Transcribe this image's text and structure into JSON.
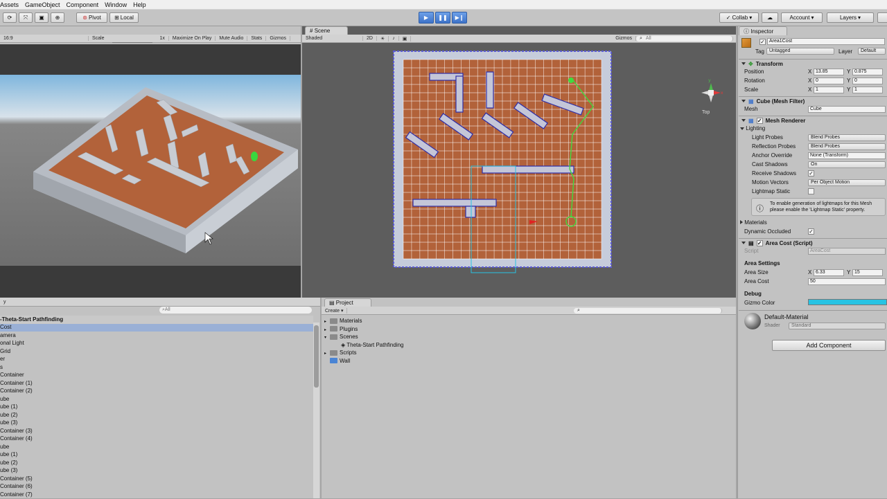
{
  "menu": [
    "Assets",
    "GameObject",
    "Component",
    "Window",
    "Help"
  ],
  "toolbar": {
    "pivot": "Pivot",
    "local": "Local",
    "collab": "Collab",
    "account": "Account",
    "layers": "Layers"
  },
  "game_view": {
    "aspect": "16:9",
    "scale_label": "Scale",
    "scale_value": "1x",
    "options": [
      "Maximize On Play",
      "Mute Audio",
      "Stats",
      "Gizmos"
    ]
  },
  "scene_view": {
    "tab": "Scene",
    "shading": "Shaded",
    "mode_2d": "2D",
    "gizmos": "Gizmos",
    "search_placeholder": "All",
    "orientation": "Top"
  },
  "hierarchy": {
    "search_placeholder": "All",
    "scene_name": "Theta-Start Pathfinding",
    "items": [
      "Cost",
      "amera",
      "onal Light",
      "Grid",
      "er",
      "s",
      "Container",
      "Container (1)",
      "Container (2)",
      "ube",
      "ube (1)",
      "ube (2)",
      "ube (3)",
      "Container (3)",
      "Container (4)",
      "ube",
      "ube (1)",
      "ube (2)",
      "ube (3)",
      "Container (5)",
      "Container (6)",
      "Container (7)"
    ]
  },
  "project": {
    "tab": "Project",
    "create": "Create",
    "items": [
      {
        "label": "Materials",
        "indent": 0,
        "type": "folder"
      },
      {
        "label": "Plugins",
        "indent": 0,
        "type": "folder"
      },
      {
        "label": "Scenes",
        "indent": 0,
        "type": "folder-open"
      },
      {
        "label": "Theta-Start Pathfinding",
        "indent": 1,
        "type": "scene"
      },
      {
        "label": "Scripts",
        "indent": 0,
        "type": "folder"
      },
      {
        "label": "Wall",
        "indent": 0,
        "type": "prefab"
      }
    ]
  },
  "inspector": {
    "tab": "Inspector",
    "object_name": "Area1Cost",
    "tag_label": "Tag",
    "tag_value": "Untagged",
    "layer_label": "Layer",
    "layer_value": "Default",
    "transform": {
      "title": "Transform",
      "position_label": "Position",
      "position_x": "13.85",
      "position_y": "0.875",
      "rotation_label": "Rotation",
      "rotation_x": "0",
      "rotation_y": "0",
      "scale_label": "Scale",
      "scale_x": "1",
      "scale_y": "1"
    },
    "mesh_filter": {
      "title": "Cube (Mesh Filter)",
      "mesh_label": "Mesh",
      "mesh_value": "Cube"
    },
    "mesh_renderer": {
      "title": "Mesh Renderer",
      "lighting": "Lighting",
      "light_probes_label": "Light Probes",
      "light_probes_value": "Blend Probes",
      "reflection_probes_label": "Reflection Probes",
      "reflection_probes_value": "Blend Probes",
      "anchor_override_label": "Anchor Override",
      "anchor_override_value": "None (Transform)",
      "cast_shadows_label": "Cast Shadows",
      "cast_shadows_value": "On",
      "receive_shadows_label": "Receive Shadows",
      "motion_vectors_label": "Motion Vectors",
      "motion_vectors_value": "Per Object Motion",
      "lightmap_static_label": "Lightmap Static",
      "info_text_1": "To enable generation of lightmaps for this Mesh",
      "info_text_2": "please enable the 'Lightmap Static' property.",
      "materials_label": "Materials",
      "dynamic_occluded_label": "Dynamic Occluded"
    },
    "area_cost": {
      "title": "Area Cost (Script)",
      "script_label": "Script",
      "script_value": "AreaCost",
      "settings_header": "Area Settings",
      "area_size_label": "Area Size",
      "area_size_x": "6.33",
      "area_size_y": "15",
      "area_cost_label": "Area Cost",
      "area_cost_value": "50",
      "debug_header": "Debug",
      "gizmo_color_label": "Gizmo Color",
      "gizmo_color": "#27c3e3"
    },
    "material": {
      "name": "Default-Material",
      "shader_label": "Shader",
      "shader_value": "Standard"
    },
    "add_component": "Add Component"
  },
  "colors": {
    "floor": "#b2623a",
    "wall": "#c6cdd8",
    "highlight_blue": "#3d72c8",
    "path_green": "#3fdc3f"
  }
}
